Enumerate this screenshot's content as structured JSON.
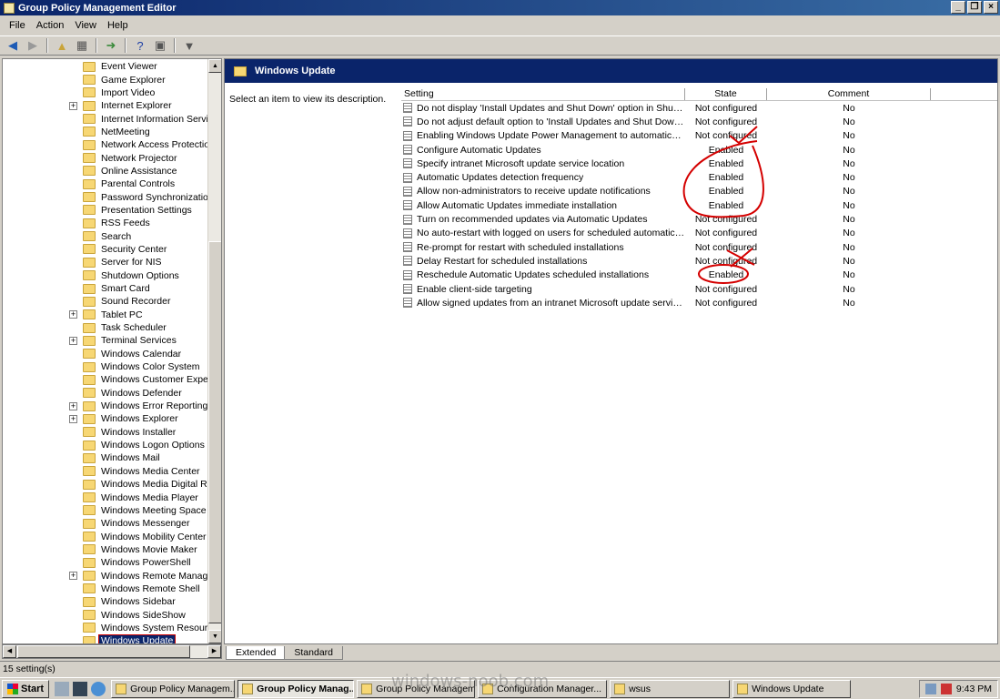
{
  "window": {
    "title": "Group Policy Management Editor"
  },
  "title_buttons": [
    "_",
    "❐",
    "×"
  ],
  "menu": [
    "File",
    "Action",
    "View",
    "Help"
  ],
  "tree": {
    "items": [
      {
        "label": "Event Viewer",
        "expandable": false
      },
      {
        "label": "Game Explorer",
        "expandable": false
      },
      {
        "label": "Import Video",
        "expandable": false
      },
      {
        "label": "Internet Explorer",
        "expandable": true
      },
      {
        "label": "Internet Information Servic",
        "expandable": false
      },
      {
        "label": "NetMeeting",
        "expandable": false
      },
      {
        "label": "Network Access Protection",
        "expandable": false
      },
      {
        "label": "Network Projector",
        "expandable": false
      },
      {
        "label": "Online Assistance",
        "expandable": false
      },
      {
        "label": "Parental Controls",
        "expandable": false
      },
      {
        "label": "Password Synchronization",
        "expandable": false
      },
      {
        "label": "Presentation Settings",
        "expandable": false
      },
      {
        "label": "RSS Feeds",
        "expandable": false
      },
      {
        "label": "Search",
        "expandable": false
      },
      {
        "label": "Security Center",
        "expandable": false
      },
      {
        "label": "Server for NIS",
        "expandable": false
      },
      {
        "label": "Shutdown Options",
        "expandable": false
      },
      {
        "label": "Smart Card",
        "expandable": false
      },
      {
        "label": "Sound Recorder",
        "expandable": false
      },
      {
        "label": "Tablet PC",
        "expandable": true
      },
      {
        "label": "Task Scheduler",
        "expandable": false
      },
      {
        "label": "Terminal Services",
        "expandable": true
      },
      {
        "label": "Windows Calendar",
        "expandable": false
      },
      {
        "label": "Windows Color System",
        "expandable": false
      },
      {
        "label": "Windows Customer Experie",
        "expandable": false
      },
      {
        "label": "Windows Defender",
        "expandable": false
      },
      {
        "label": "Windows Error Reporting",
        "expandable": true
      },
      {
        "label": "Windows Explorer",
        "expandable": true
      },
      {
        "label": "Windows Installer",
        "expandable": false
      },
      {
        "label": "Windows Logon Options",
        "expandable": false
      },
      {
        "label": "Windows Mail",
        "expandable": false
      },
      {
        "label": "Windows Media Center",
        "expandable": false
      },
      {
        "label": "Windows Media Digital Right",
        "expandable": false
      },
      {
        "label": "Windows Media Player",
        "expandable": false
      },
      {
        "label": "Windows Meeting Space",
        "expandable": false
      },
      {
        "label": "Windows Messenger",
        "expandable": false
      },
      {
        "label": "Windows Mobility Center",
        "expandable": false
      },
      {
        "label": "Windows Movie Maker",
        "expandable": false
      },
      {
        "label": "Windows PowerShell",
        "expandable": false
      },
      {
        "label": "Windows Remote Managem",
        "expandable": true
      },
      {
        "label": "Windows Remote Shell",
        "expandable": false
      },
      {
        "label": "Windows Sidebar",
        "expandable": false
      },
      {
        "label": "Windows SideShow",
        "expandable": false
      },
      {
        "label": "Windows System Resource",
        "expandable": false
      },
      {
        "label": "Windows Update",
        "expandable": false,
        "selected": true
      }
    ]
  },
  "main": {
    "header_title": "Windows Update",
    "description": "Select an item to view its description.",
    "columns": {
      "setting": "Setting",
      "state": "State",
      "comment": "Comment"
    },
    "rows": [
      {
        "setting": "Do not display 'Install Updates and Shut Down' option in Shut Do...",
        "state": "Not configured",
        "comment": "No"
      },
      {
        "setting": "Do not adjust default option to 'Install Updates and Shut Down' in...",
        "state": "Not configured",
        "comment": "No"
      },
      {
        "setting": "Enabling Windows Update Power Management to automatically w...",
        "state": "Not configured",
        "comment": "No"
      },
      {
        "setting": "Configure Automatic Updates",
        "state": "Enabled",
        "comment": "No"
      },
      {
        "setting": "Specify intranet Microsoft update service location",
        "state": "Enabled",
        "comment": "No"
      },
      {
        "setting": "Automatic Updates detection frequency",
        "state": "Enabled",
        "comment": "No"
      },
      {
        "setting": "Allow non-administrators to receive update notifications",
        "state": "Enabled",
        "comment": "No"
      },
      {
        "setting": "Allow Automatic Updates immediate installation",
        "state": "Enabled",
        "comment": "No"
      },
      {
        "setting": "Turn on recommended updates via Automatic Updates",
        "state": "Not configured",
        "comment": "No"
      },
      {
        "setting": "No auto-restart with logged on users for scheduled automatic up...",
        "state": "Not configured",
        "comment": "No"
      },
      {
        "setting": "Re-prompt for restart with scheduled installations",
        "state": "Not configured",
        "comment": "No"
      },
      {
        "setting": "Delay Restart for scheduled installations",
        "state": "Not configured",
        "comment": "No"
      },
      {
        "setting": "Reschedule Automatic Updates scheduled installations",
        "state": "Enabled",
        "comment": "No"
      },
      {
        "setting": "Enable client-side targeting",
        "state": "Not configured",
        "comment": "No"
      },
      {
        "setting": "Allow signed updates from an intranet Microsoft update service lo...",
        "state": "Not configured",
        "comment": "No"
      }
    ],
    "annotation_color": "#d40000"
  },
  "tabs": [
    "Extended",
    "Standard"
  ],
  "status": "15 setting(s)",
  "taskbar": {
    "start_label": "Start",
    "tasks": [
      {
        "label": "Group Policy Managem...",
        "active": false
      },
      {
        "label": "Group Policy Manag...",
        "active": true
      },
      {
        "label": "Group Policy Managem...",
        "active": false
      },
      {
        "label": "Configuration Manager...",
        "active": false
      },
      {
        "label": "wsus",
        "active": false
      },
      {
        "label": "Windows Update",
        "active": false
      }
    ],
    "clock": "9:43 PM"
  },
  "watermark": "windows-noob.com"
}
